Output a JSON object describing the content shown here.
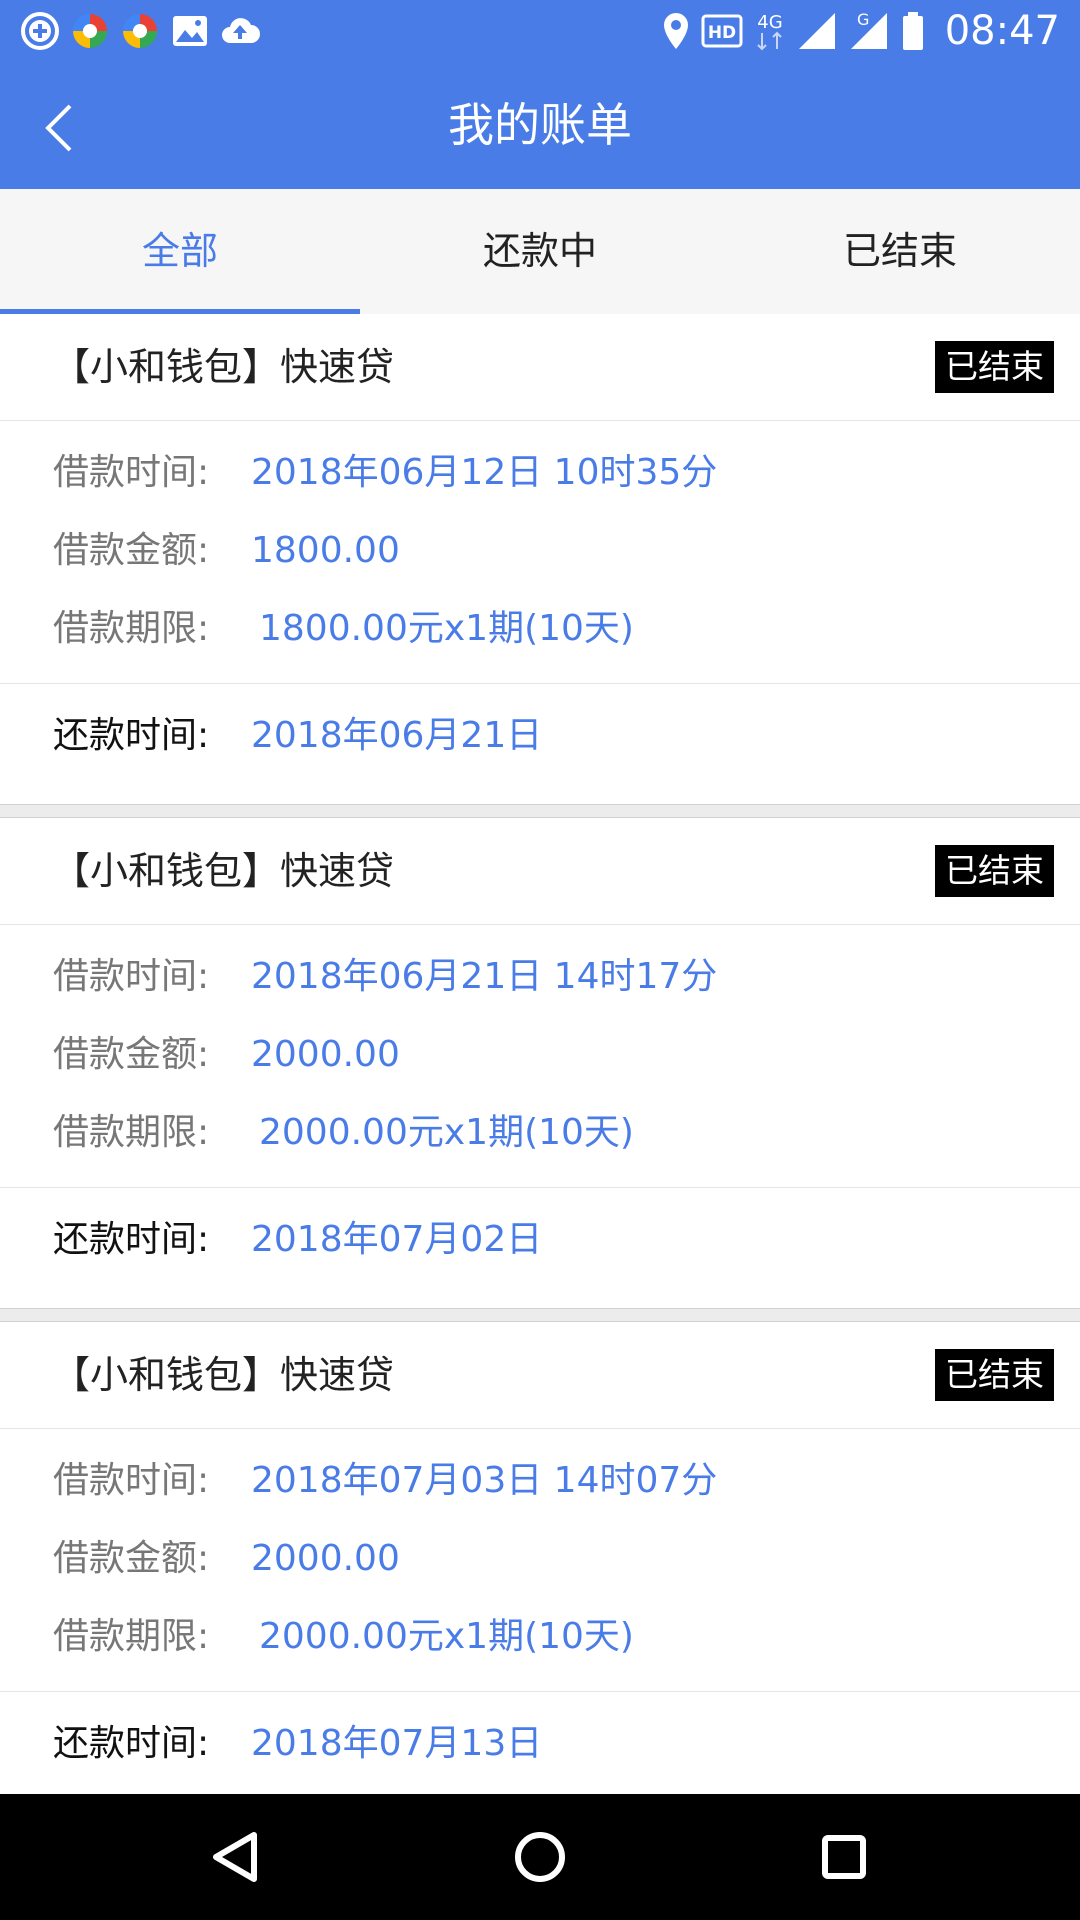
{
  "status_bar": {
    "time": "08:47",
    "network": "4G",
    "network2": "G",
    "hd": "HD",
    "left_icons": [
      "add-circle-icon",
      "app-colorful-icon",
      "app-colorful-icon",
      "image-icon",
      "cloud-upload-icon"
    ],
    "right_icons": [
      "location-icon",
      "hd-icon",
      "signal-icon",
      "signal-icon",
      "battery-icon"
    ]
  },
  "header": {
    "title": "我的账单",
    "back_icon": "chevron-left-icon"
  },
  "tabs": [
    {
      "label": "全部",
      "active": true
    },
    {
      "label": "还款中",
      "active": false
    },
    {
      "label": "已结束",
      "active": false
    }
  ],
  "bills": [
    {
      "title": "【小和钱包】快速贷",
      "status": "已结束",
      "borrow_time_label": "借款时间:",
      "borrow_time": "2018年06月12日 10时35分",
      "amount_label": "借款金额:",
      "amount": "1800.00",
      "term_label": "借款期限:",
      "term": "1800.00元x1期(10天)",
      "repay_label": "还款时间:",
      "repay_time": "2018年06月21日"
    },
    {
      "title": "【小和钱包】快速贷",
      "status": "已结束",
      "borrow_time_label": "借款时间:",
      "borrow_time": "2018年06月21日 14时17分",
      "amount_label": "借款金额:",
      "amount": "2000.00",
      "term_label": "借款期限:",
      "term": "2000.00元x1期(10天)",
      "repay_label": "还款时间:",
      "repay_time": "2018年07月02日"
    },
    {
      "title": "【小和钱包】快速贷",
      "status": "已结束",
      "borrow_time_label": "借款时间:",
      "borrow_time": "2018年07月03日 14时07分",
      "amount_label": "借款金额:",
      "amount": "2000.00",
      "term_label": "借款期限:",
      "term": "2000.00元x1期(10天)",
      "repay_label": "还款时间:",
      "repay_time": "2018年07月13日"
    }
  ],
  "nav_bar": {
    "icons": [
      "back-triangle-icon",
      "home-circle-icon",
      "recents-square-icon"
    ]
  },
  "colors": {
    "accent": "#4a7ce8",
    "badge_bg": "#000000",
    "label": "#777777"
  }
}
